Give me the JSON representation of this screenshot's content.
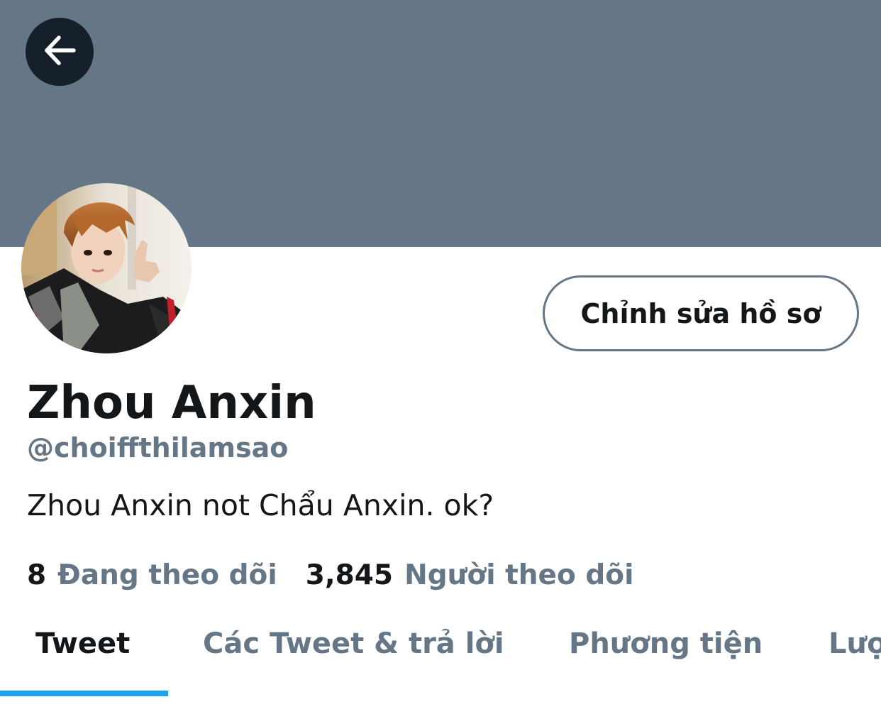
{
  "header": {
    "back_icon": "arrow-left-icon",
    "banner_color": "#657786"
  },
  "profile": {
    "edit_button_label": "Chỉnh sửa hồ sơ",
    "display_name": "Zhou Anxin",
    "handle": "@choiffthilamsao",
    "bio": "Zhou Anxin not Chẩu Anxin. ok?",
    "following_count": "8",
    "following_label": "Đang theo dõi",
    "followers_count": "3,845",
    "followers_label": "Người theo dõi"
  },
  "tabs": [
    {
      "label": "Tweet",
      "active": true
    },
    {
      "label": "Các Tweet & trả lời",
      "active": false
    },
    {
      "label": "Phương tiện",
      "active": false
    },
    {
      "label": "Lượt thích",
      "active": false
    }
  ],
  "colors": {
    "accent": "#1da1f2",
    "primary_text": "#14171a",
    "secondary_text": "#657786"
  }
}
